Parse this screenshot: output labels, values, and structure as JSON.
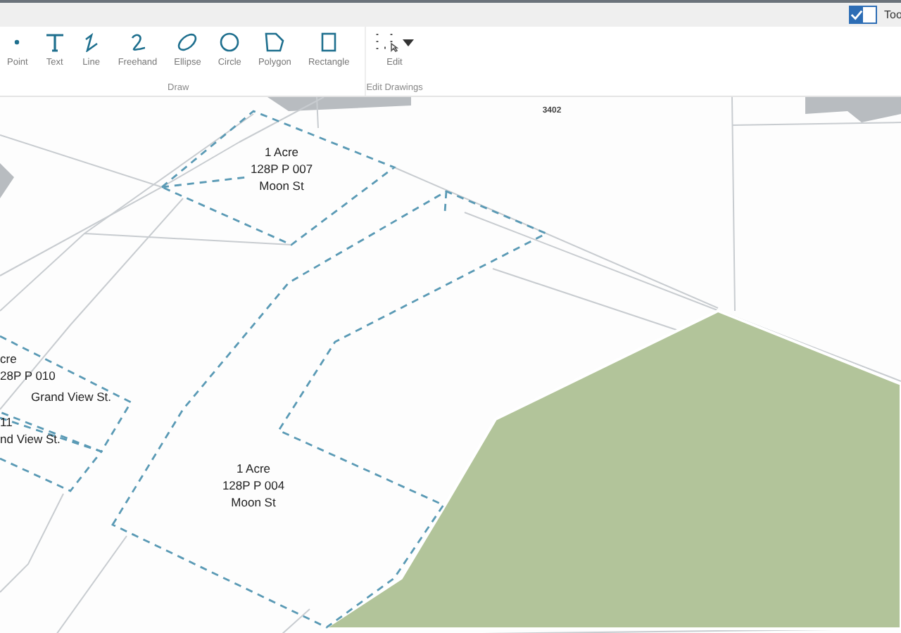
{
  "top_bar": {
    "checkbox_checked": true,
    "label": "Too"
  },
  "toolbar": {
    "groups": [
      {
        "label": "Draw",
        "tools": [
          {
            "kind": "point",
            "label": "Point"
          },
          {
            "kind": "text",
            "label": "Text"
          },
          {
            "kind": "line",
            "label": "Line"
          },
          {
            "kind": "freehand",
            "label": "Freehand"
          },
          {
            "kind": "ellipse",
            "label": "Ellipse"
          },
          {
            "kind": "circle",
            "label": "Circle"
          },
          {
            "kind": "polygon",
            "label": "Polygon"
          },
          {
            "kind": "rectangle",
            "label": "Rectangle"
          }
        ]
      },
      {
        "label": "Edit Drawings",
        "tools": [
          {
            "kind": "edit",
            "label": "Edit"
          }
        ]
      }
    ]
  },
  "map": {
    "labels": [
      {
        "kind": "parcel",
        "lines": [
          "1 Acre",
          "128P P 007",
          "Moon St"
        ]
      },
      {
        "kind": "parcel",
        "lines": [
          "1 Acre",
          "128P P 004",
          "Moon St"
        ]
      },
      {
        "kind": "parcel",
        "lines": [
          "cre",
          "28P P 010"
        ]
      },
      {
        "kind": "street",
        "lines": [
          "Grand View St."
        ]
      },
      {
        "kind": "parcel",
        "lines": [
          "11",
          "nd View St."
        ]
      },
      {
        "kind": "lot",
        "lines": [
          "3402"
        ]
      }
    ]
  }
}
